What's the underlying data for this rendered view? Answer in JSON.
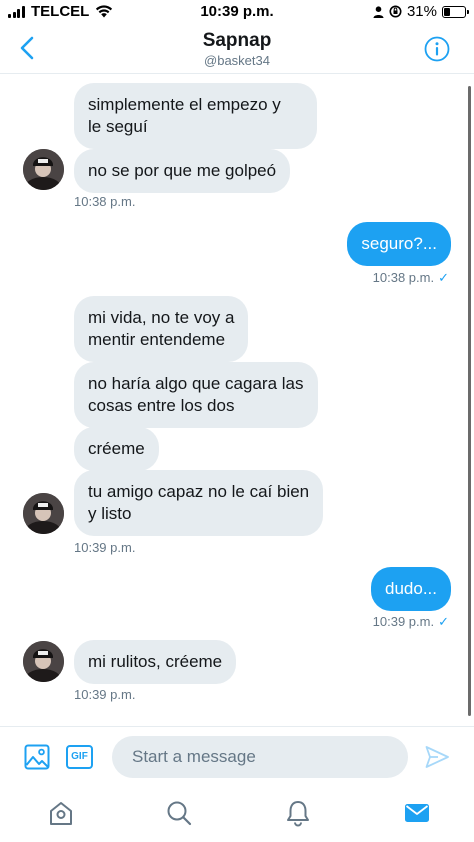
{
  "status_bar": {
    "carrier": "TELCEL",
    "time": "10:39 p.m.",
    "battery": "31%",
    "battery_level": 0.31
  },
  "header": {
    "name": "Sapnap",
    "handle": "@basket34",
    "back_icon": "chevron-left-icon",
    "info_icon": "info-icon"
  },
  "messages": [
    {
      "text_lines": [
        "simplemente el empezo y",
        "le seguí"
      ],
      "direction": "in"
    },
    {
      "text": "no se por que me golpeó",
      "direction": "in"
    },
    {
      "text": "seguro?...",
      "direction": "out"
    },
    {
      "text_lines": [
        "mi vida, no te voy a",
        "mentir entendeme"
      ],
      "direction": "in"
    },
    {
      "text_lines": [
        "no haría algo que cagara las",
        "cosas entre los dos"
      ],
      "direction": "in"
    },
    {
      "text": "créeme",
      "direction": "in"
    },
    {
      "text_lines": [
        "tu amigo capaz no le caí bien",
        "y listo"
      ],
      "direction": "in"
    },
    {
      "text": "dudo...",
      "direction": "out"
    },
    {
      "text": "mi rulitos, créeme",
      "direction": "in"
    }
  ],
  "timestamps": [
    "10:38 p.m.",
    "10:38 p.m.",
    "10:39 p.m.",
    "10:39 p.m.",
    "10:39 p.m."
  ],
  "read_check": "✓",
  "composer": {
    "placeholder": "Start a message",
    "gif_label": "GIF"
  },
  "tabs": [
    "home-icon",
    "search-icon",
    "notifications-icon",
    "messages-icon"
  ],
  "colors": {
    "accent": "#1da1f2",
    "incoming_bubble": "#e6ecf0",
    "secondary_text": "#657786"
  }
}
